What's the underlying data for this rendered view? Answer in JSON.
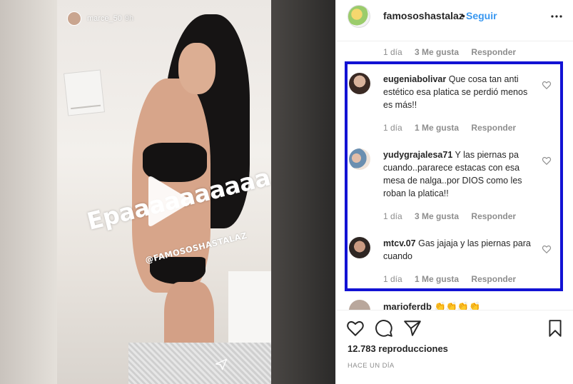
{
  "story": {
    "username": "marce_50",
    "time": "9h",
    "caption": "Epaaaaaaaaaa",
    "tag": "@FAMOSOSHASTALAZ"
  },
  "header": {
    "username": "famososhastalaz",
    "separator": "•",
    "follow_label": "Seguir"
  },
  "comments_top_meta": {
    "time": "1 día",
    "likes": "3 Me gusta",
    "reply": "Responder"
  },
  "comments": [
    {
      "username": "eugeniabolivar",
      "text": "Que cosa tan anti estético esa platica se perdió menos es más!!",
      "time": "1 día",
      "likes": "1 Me gusta",
      "reply": "Responder"
    },
    {
      "username": "yudygrajalesa71",
      "text": "Y las piernas pa cuando..pararece estacas con esa mesa de nalga..por DIOS como les roban la platica!!",
      "time": "1 día",
      "likes": "3 Me gusta",
      "reply": "Responder"
    },
    {
      "username": "mtcv.07",
      "text": "Gas jajaja y las piernas para cuando",
      "time": "1 día",
      "likes": "1 Me gusta",
      "reply": "Responder"
    }
  ],
  "partial_comment": {
    "username": "marioferdb 👏👏👏👏"
  },
  "footer": {
    "views_count": "12.783",
    "views_label": "reproducciones",
    "posted": "HACE UN DÍA"
  },
  "colors": {
    "link_blue": "#3897f0",
    "highlight_blue": "#1212d4",
    "meta_gray": "#8e8e8e"
  },
  "icons": [
    "play-icon",
    "send-icon",
    "more-icon",
    "heart-icon",
    "comment-icon",
    "share-icon",
    "bookmark-icon"
  ]
}
